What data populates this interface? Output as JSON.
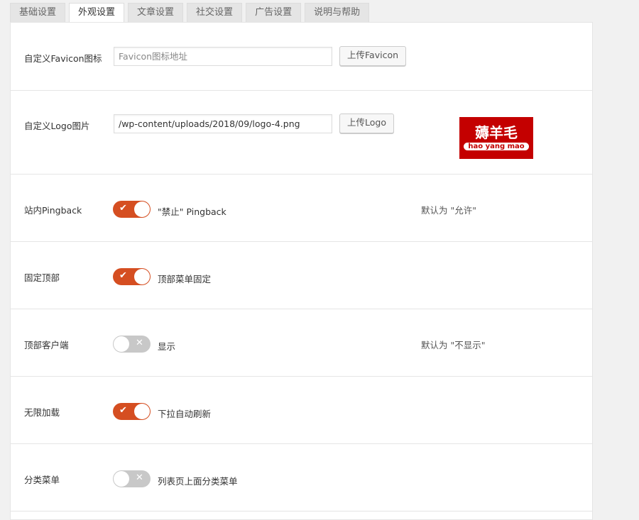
{
  "tabs": [
    "基础设置",
    "外观设置",
    "文章设置",
    "社交设置",
    "广告设置",
    "说明与帮助"
  ],
  "active_tab": 1,
  "favicon": {
    "label": "自定义Favicon图标",
    "placeholder": "Favicon图标地址",
    "value": "",
    "button": "上传Favicon"
  },
  "logo": {
    "label": "自定义Logo图片",
    "value": "/wp-content/uploads/2018/09/logo-4.png",
    "button": "上传Logo",
    "preview_text": "薅羊毛",
    "preview_sub": "hao yang mao"
  },
  "toggles": [
    {
      "label": "站内Pingback",
      "on": true,
      "text": "\"禁止\" Pingback",
      "note": "默认为 \"允许\""
    },
    {
      "label": "固定顶部",
      "on": true,
      "text": "顶部菜单固定",
      "note": ""
    },
    {
      "label": "顶部客户端",
      "on": false,
      "text": "显示",
      "note": "默认为 \"不显示\""
    },
    {
      "label": "无限加载",
      "on": true,
      "text": "下拉自动刷新",
      "note": ""
    },
    {
      "label": "分类菜单",
      "on": false,
      "text": "列表页上面分类菜单",
      "note": ""
    }
  ],
  "colors": {
    "accent": "#d54e21",
    "off": "#c8c8c8",
    "logo_bg": "#c40000"
  }
}
